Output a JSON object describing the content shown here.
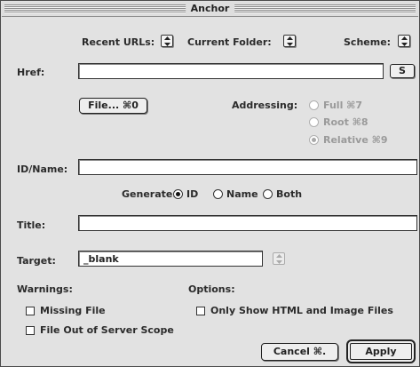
{
  "window": {
    "title": "Anchor"
  },
  "top_menus": {
    "recent_urls": "Recent URLs:",
    "current_folder": "Current Folder:",
    "scheme": "Scheme:"
  },
  "href": {
    "label": "Href:",
    "value": "",
    "button": "S"
  },
  "file_button": "File... ⌘0",
  "addressing": {
    "label": "Addressing:",
    "options": [
      {
        "label": "Full ⌘7",
        "selected": false,
        "enabled": false
      },
      {
        "label": "Root ⌘8",
        "selected": false,
        "enabled": false
      },
      {
        "label": "Relative ⌘9",
        "selected": true,
        "enabled": false
      }
    ]
  },
  "id_name": {
    "label": "ID/Name:",
    "value": ""
  },
  "generate": {
    "label": "Generate:",
    "options": [
      {
        "label": "ID",
        "selected": true
      },
      {
        "label": "Name",
        "selected": false
      },
      {
        "label": "Both",
        "selected": false
      }
    ]
  },
  "title_field": {
    "label": "Title:",
    "value": ""
  },
  "target": {
    "label": "Target:",
    "value": "_blank"
  },
  "warnings": {
    "label": "Warnings:",
    "items": [
      {
        "label": "Missing File",
        "checked": false
      },
      {
        "label": "File Out of Server Scope",
        "checked": false
      }
    ]
  },
  "options": {
    "label": "Options:",
    "items": [
      {
        "label": "Only Show HTML and Image Files",
        "checked": false
      }
    ]
  },
  "buttons": {
    "cancel": "Cancel ⌘.",
    "apply": "Apply"
  }
}
